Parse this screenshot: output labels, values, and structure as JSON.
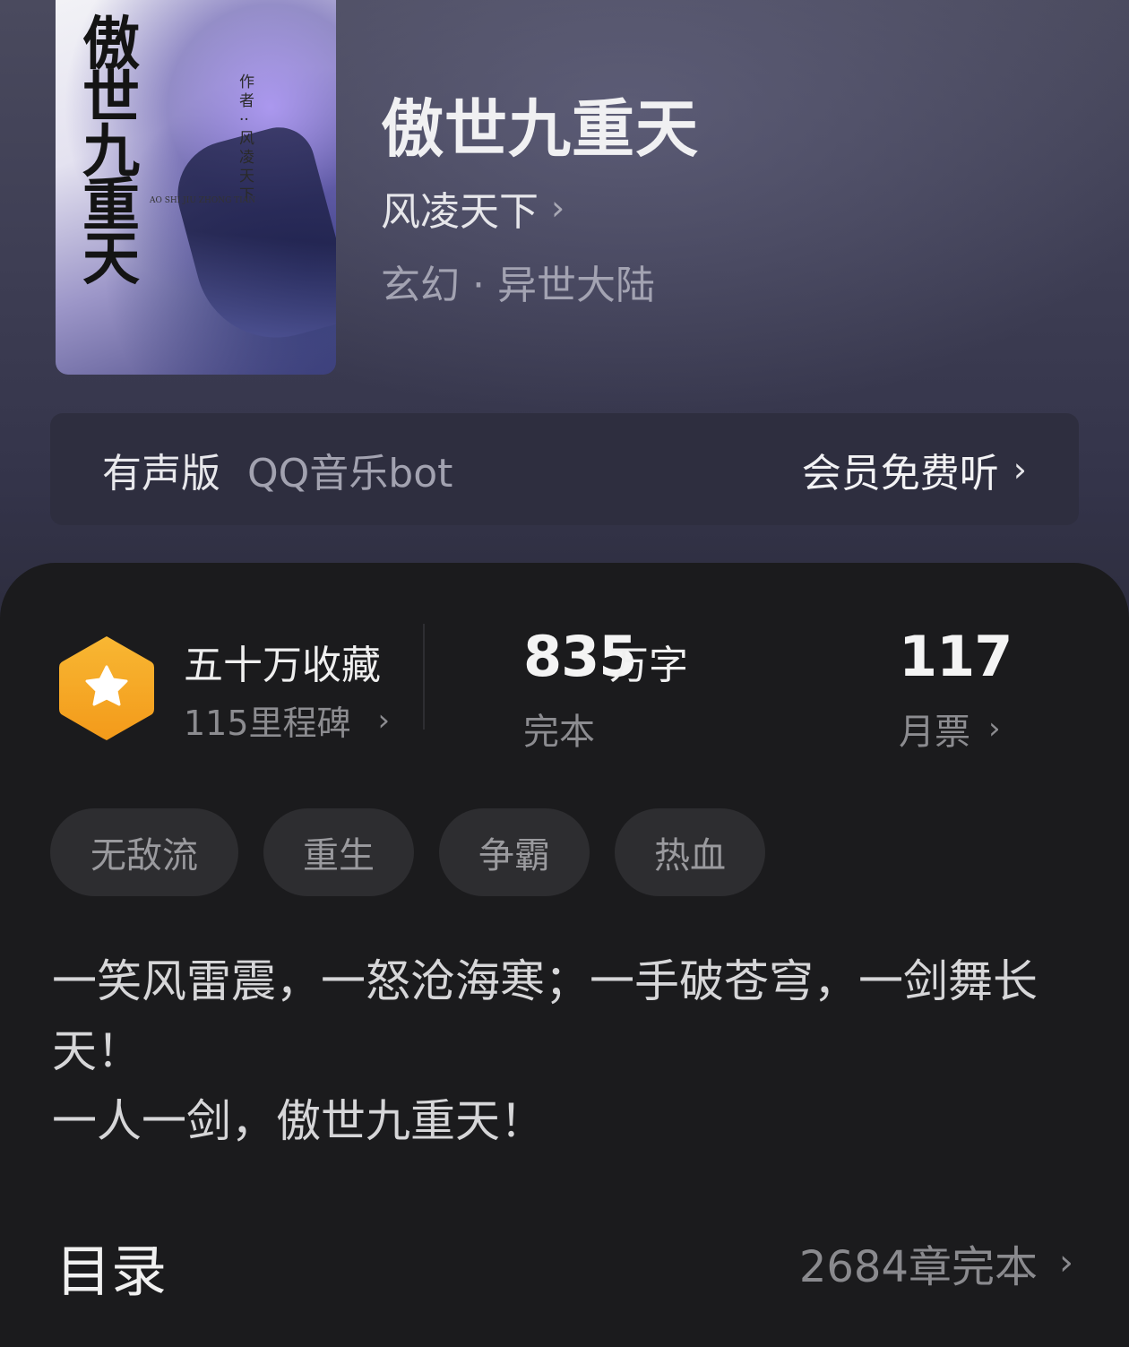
{
  "book": {
    "title": "傲世九重天",
    "author": "风凌天下",
    "genre": "玄幻 · 异世大陆",
    "cover": {
      "title": "傲世九重",
      "title_last": "天",
      "author_line": "作者··风凌天下",
      "pinyin": "AO SHI JIU ZHONG TIAN"
    }
  },
  "audio": {
    "label": "有声版",
    "source": "QQ音乐bot",
    "cta": "会员免费听"
  },
  "stats": {
    "badge_title": "五十万收藏",
    "badge_sub": "115里程碑",
    "word_count": "835",
    "word_unit": "万字",
    "status": "完本",
    "votes": "117",
    "votes_label": "月票"
  },
  "tags": [
    "无敌流",
    "重生",
    "争霸",
    "热血"
  ],
  "description": {
    "line1": "一笑风雷震，一怒沧海寒；一手破苍穹，一剑舞长天！",
    "line2": "一人一剑，傲世九重天！"
  },
  "toc": {
    "title": "目录",
    "info": "2684章完本"
  },
  "colors": {
    "badge": "#f6a623",
    "panel_bg": "#1b1b1d",
    "tag_bg": "#2d2d30"
  },
  "icons": {
    "chevron": "chevron-right-icon",
    "badge": "star-hexagon-icon"
  }
}
